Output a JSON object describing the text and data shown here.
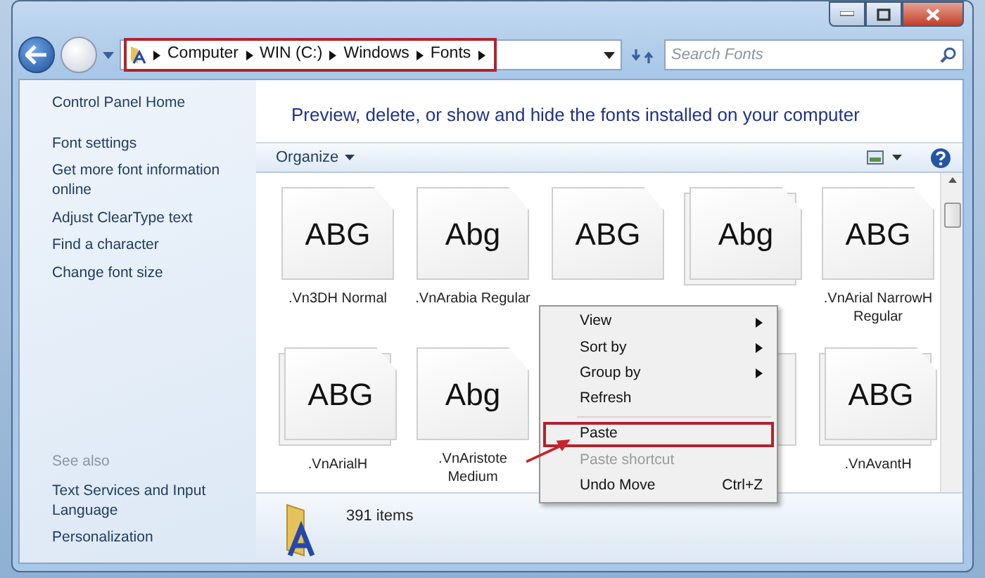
{
  "address": {
    "highlighted": true,
    "crumbs": [
      "Computer",
      "WIN (C:)",
      "Windows",
      "Fonts"
    ]
  },
  "search": {
    "placeholder": "Search Fonts"
  },
  "sidebar": {
    "links": [
      "Control Panel Home",
      "Font settings",
      "Get more font information online",
      "Adjust ClearType text",
      "Find a character",
      "Change font size"
    ],
    "see_also_heading": "See also",
    "see_also": [
      "Text Services and Input Language",
      "Personalization"
    ]
  },
  "header": "Preview, delete, or show and hide the fonts installed on your computer",
  "toolbar": {
    "organize": "Organize"
  },
  "fonts": [
    {
      "kind": "single",
      "sample": "ABG",
      "label": ".Vn3DH  Normal"
    },
    {
      "kind": "single",
      "sample": "Abg",
      "label": ".VnArabia Regular"
    },
    {
      "kind": "single",
      "sample": "ABG"
    },
    {
      "kind": "stacked",
      "sample": "Abg"
    },
    {
      "kind": "single",
      "sample": "ABG",
      "label": ".VnArial NarrowH Regular"
    },
    {
      "kind": "stacked",
      "sample": "ABG",
      "label": ".VnArialH"
    },
    {
      "kind": "single",
      "sample": "Abg",
      "label": ".VnAristote Medium"
    },
    {
      "kind": "hidden"
    },
    {
      "kind": "covered"
    },
    {
      "kind": "stacked",
      "sample": "ABG",
      "label": ".VnAvantH"
    }
  ],
  "context_menu": [
    {
      "kind": "item",
      "label": "View",
      "submenu": true,
      "disabled": false,
      "highlighted": false
    },
    {
      "kind": "item",
      "label": "Sort by",
      "submenu": true,
      "disabled": false,
      "highlighted": false
    },
    {
      "kind": "item",
      "label": "Group by",
      "submenu": true,
      "disabled": false,
      "highlighted": false
    },
    {
      "kind": "item",
      "label": "Refresh",
      "submenu": false,
      "disabled": false,
      "highlighted": false
    },
    {
      "kind": "separator"
    },
    {
      "kind": "item",
      "label": "Paste",
      "submenu": false,
      "disabled": false,
      "highlighted": true
    },
    {
      "kind": "item",
      "label": "Paste shortcut",
      "submenu": false,
      "disabled": true,
      "highlighted": false
    },
    {
      "kind": "item",
      "label": "Undo Move",
      "shortcut": "Ctrl+Z",
      "submenu": false,
      "disabled": false,
      "highlighted": false
    }
  ],
  "status_bar": {
    "count": "391 items"
  }
}
